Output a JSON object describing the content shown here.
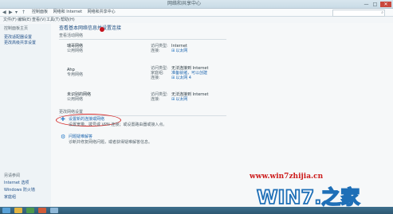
{
  "window": {
    "title": "网络和共享中心",
    "buttons": {
      "minimize": "—",
      "maximize": "□",
      "close": "✕"
    }
  },
  "address": {
    "breadcrumb": [
      "控制面板",
      "网络和 Internet",
      "网络和共享中心"
    ],
    "search_placeholder": "搜索控制面板"
  },
  "menu": [
    "文件(F)",
    "编辑(E)",
    "查看(V)",
    "工具(T)",
    "帮助(H)"
  ],
  "sidebar": {
    "home": "控制面板主页",
    "items": [
      "更改适配器设置",
      "更改高级共享设置"
    ],
    "see_also_header": "另请参阅",
    "see_also": [
      "Internet 选项",
      "Windows 防火墙",
      "家庭组"
    ]
  },
  "main": {
    "title": "查看基本网络信息并设置连接",
    "active_networks_header": "查看活动网络",
    "networks": [
      {
        "name": "瑞哥网络",
        "type": "公用网络",
        "access_label": "访问类型:",
        "access_value": "Internet",
        "conn_label": "连接:",
        "conn_value": "以太网"
      },
      {
        "name": "Ahp",
        "type": "专用网络",
        "access_label": "访问类型:",
        "access_value": "无法连接到 Internet",
        "homegroup_label": "家庭组:",
        "homegroup_value": "准备就绪，可以创建",
        "conn_label": "连接:",
        "conn_value": "以太网 4"
      },
      {
        "name": "未识别的网络",
        "type": "公用网络",
        "access_label": "访问类型:",
        "access_value": "无法连接到 Internet",
        "conn_label": "连接:",
        "conn_value": "以太网"
      }
    ],
    "change_settings_header": "更改网络设置",
    "tasks": [
      {
        "link": "设置新的连接或网络",
        "desc": "设置宽带、拨号或 VPN 连接；或设置路由器或接入点。"
      },
      {
        "link": "问题疑难解答",
        "desc": "诊断并修复网络问题，或者获得疑难解答信息。"
      }
    ]
  },
  "watermark": {
    "url": "www.win7zhijia.cn",
    "logo_text": "WIN7.之家"
  }
}
